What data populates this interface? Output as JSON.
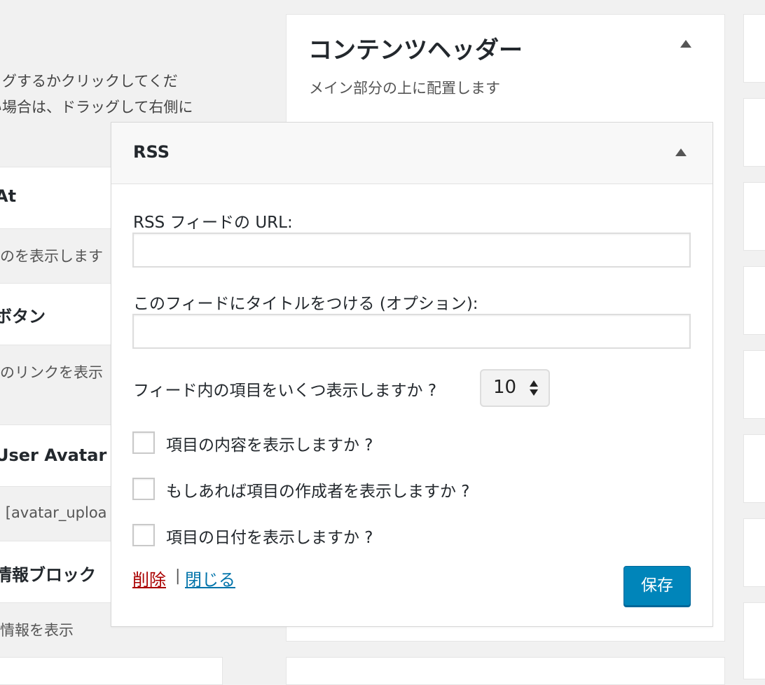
{
  "left_column": {
    "help_lines": [
      "ッグするかクリックしてくだ",
      "い場合は、ドラッグして右側に"
    ],
    "widgets": [
      {
        "title": "At",
        "desc": "のを表示します"
      },
      {
        "title": "ボタン",
        "desc": "のリンクを表示"
      },
      {
        "title": "User Avatar",
        "desc": ": [avatar_upload]"
      },
      {
        "title": "情報ブロック",
        "desc": "情報を表示"
      }
    ]
  },
  "content_header": {
    "title": "コンテンツヘッダー",
    "desc": "メイン部分の上に配置します"
  },
  "rss_widget": {
    "title": "RSS",
    "url_label": "RSS フィードの URL:",
    "url_value": "",
    "title_label": "このフィードにタイトルをつける (オプション):",
    "title_value": "",
    "items_label": "フィード内の項目をいくつ表示しますか ?",
    "items_value": "10",
    "checkboxes": [
      {
        "label": "項目の内容を表示しますか ?",
        "checked": false
      },
      {
        "label": "もしあれば項目の作成者を表示しますか ?",
        "checked": false
      },
      {
        "label": "項目の日付を表示しますか ?",
        "checked": false
      }
    ],
    "delete_label": "削除",
    "separator": "|",
    "close_label": "閉じる",
    "save_label": "保存"
  },
  "colors": {
    "primary_button": "#0085ba",
    "delete_link": "#aa0000",
    "close_link": "#0073aa",
    "background": "#f1f1f1"
  }
}
